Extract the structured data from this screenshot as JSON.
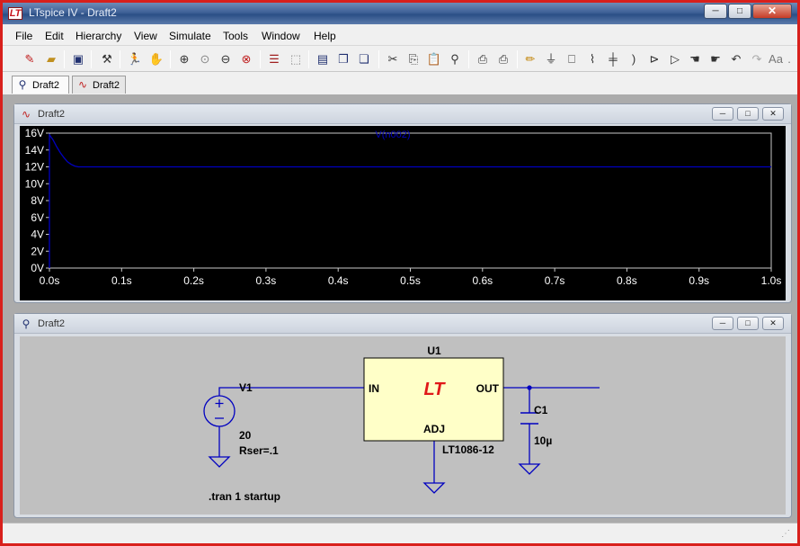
{
  "window": {
    "title": "LTspice IV - Draft2",
    "app_icon_glyph": "LT",
    "buttons": {
      "minimize": "─",
      "maximize": "□",
      "close": "✕"
    }
  },
  "menu": [
    "File",
    "Edit",
    "Hierarchy",
    "View",
    "Simulate",
    "Tools",
    "Window",
    "Help"
  ],
  "toolbar": {
    "icons": [
      "new-schematic-icon",
      "open-icon",
      "save-icon",
      "control-panel-icon",
      "run-icon",
      "halt-icon",
      "zoom-in-icon",
      "zoom-full-icon",
      "zoom-out-icon",
      "zoom-cancel-icon",
      "autorange-icon",
      "mark-unreferenced-icon",
      "tile-horizontal-icon",
      "cascade-icon",
      "close-windows-icon",
      "cut-icon",
      "copy-icon",
      "paste-icon",
      "find-icon",
      "print-setup-icon",
      "print-icon",
      "wire-icon",
      "ground-icon",
      "label-icon",
      "resistor-icon",
      "capacitor-icon",
      "inductor-icon",
      "diode-icon",
      "component-icon",
      "move-icon",
      "drag-icon",
      "undo-icon",
      "redo-icon",
      "text-icon",
      "spice-directive-icon"
    ]
  },
  "tabs": [
    {
      "label": "Draft2",
      "icon": "schematic-icon"
    },
    {
      "label": "Draft2",
      "icon": "waveform-icon"
    }
  ],
  "waveform_window": {
    "title": "Draft2",
    "icon": "waveform-icon",
    "colors": {
      "background": "#000000",
      "trace": "#0000c0",
      "axes": "#c8c8c8",
      "labels": "#ffffff"
    },
    "chart_data": {
      "type": "line",
      "series": [
        {
          "name": "V(n002)",
          "x": [
            0.0,
            0.005,
            0.01,
            0.015,
            0.02,
            0.025,
            0.03,
            0.035,
            0.04,
            0.1,
            0.5,
            1.0
          ],
          "y": [
            15.8,
            15.2,
            14.4,
            13.7,
            13.1,
            12.6,
            12.3,
            12.1,
            12.0,
            12.0,
            12.0,
            12.0
          ]
        }
      ],
      "xlim": [
        0.0,
        1.0
      ],
      "ylim": [
        0,
        16
      ],
      "xticks": [
        "0.0s",
        "0.1s",
        "0.2s",
        "0.3s",
        "0.4s",
        "0.5s",
        "0.6s",
        "0.7s",
        "0.8s",
        "0.9s",
        "1.0s"
      ],
      "yticks": [
        "0V",
        "2V",
        "4V",
        "6V",
        "8V",
        "10V",
        "12V",
        "14V",
        "16V"
      ],
      "grid": false,
      "legend_position": "top-center"
    }
  },
  "schematic_window": {
    "title": "Draft2",
    "icon": "schematic-icon",
    "colors": {
      "background": "#c0c0c0",
      "wire": "#0000c0",
      "component_fill": "#ffffc8",
      "logo": "#e01818"
    },
    "components": {
      "u1": {
        "name": "U1",
        "part": "LT1086-12",
        "pin_in": "IN",
        "pin_out": "OUT",
        "pin_adj": "ADJ",
        "logo": "LT"
      },
      "v1": {
        "name": "V1",
        "value": "20",
        "rser": "Rser=.1"
      },
      "c1": {
        "name": "C1",
        "value": "10µ"
      }
    },
    "directive": ".tran 1 startup"
  },
  "status": {
    "text": ""
  }
}
